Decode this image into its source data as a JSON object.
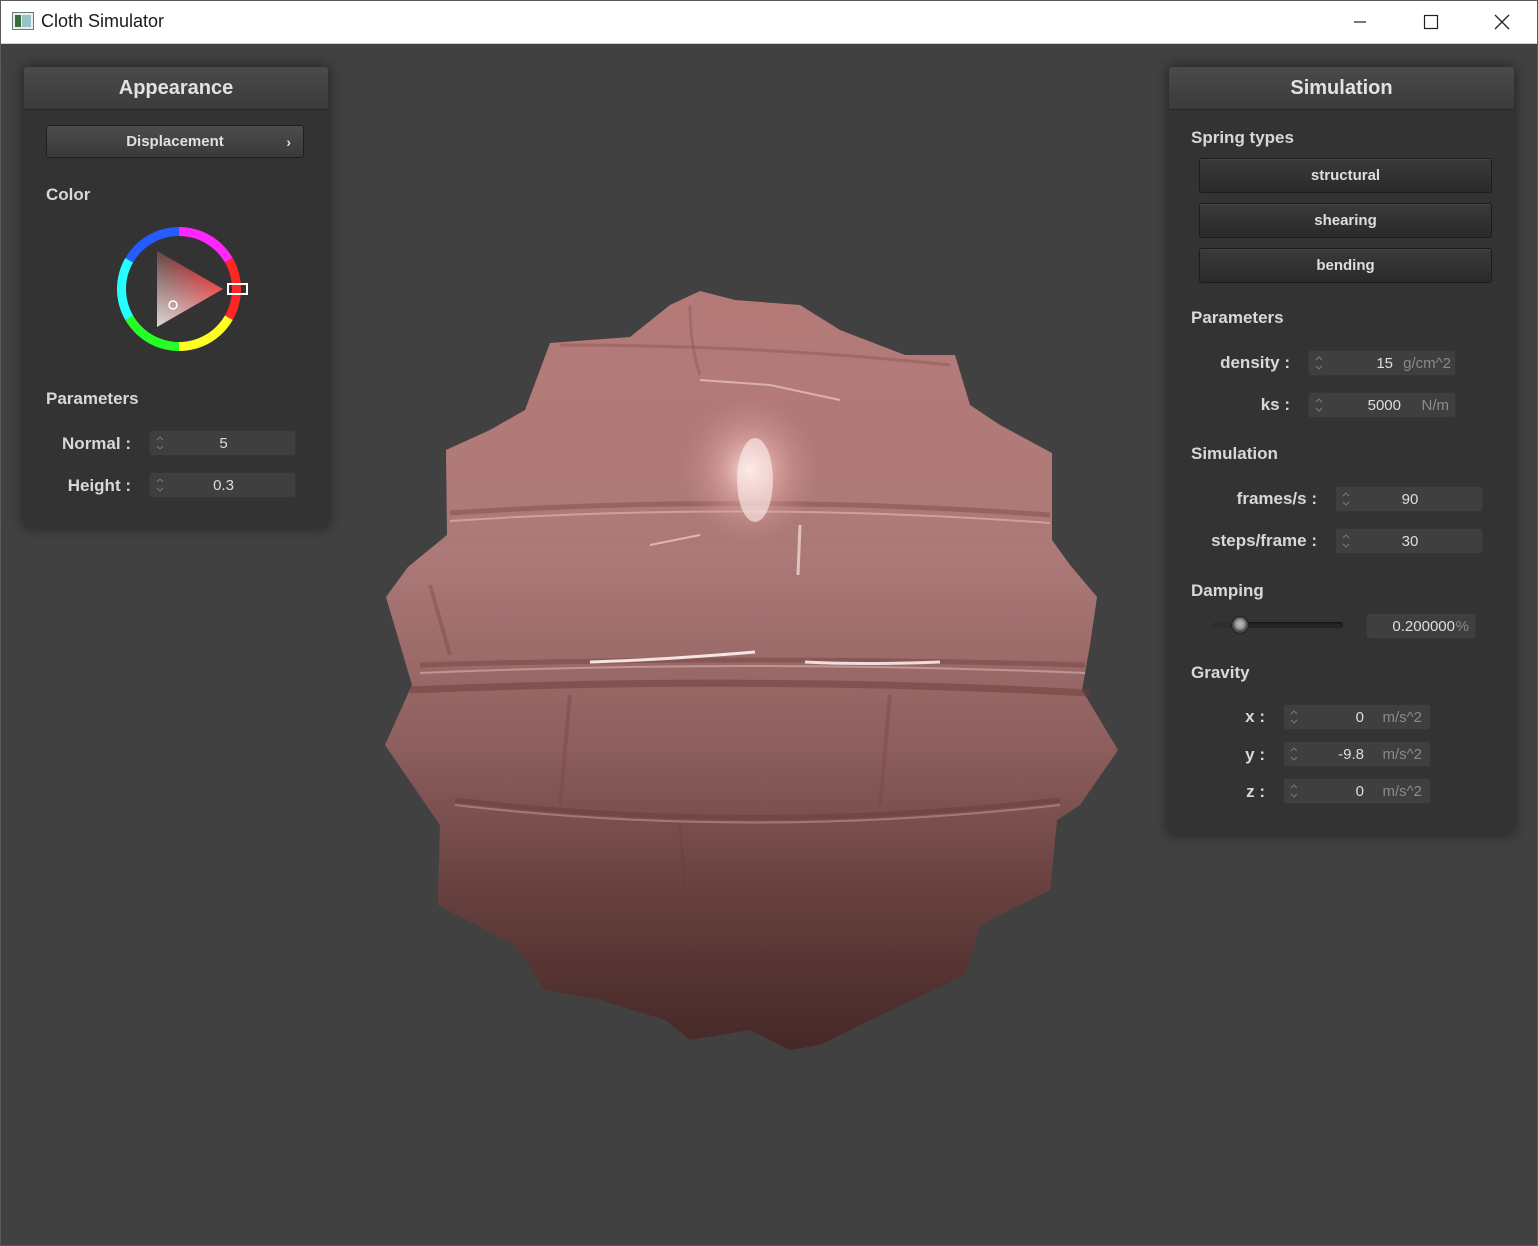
{
  "window": {
    "title": "Cloth Simulator",
    "app_icon": "app-icon"
  },
  "appearance": {
    "title": "Appearance",
    "shader_button": "Displacement",
    "color_label": "Color",
    "color_value": "#e8463c",
    "parameters_label": "Parameters",
    "normal_label": "Normal :",
    "normal_value": "5",
    "height_label": "Height :",
    "height_value": "0.3"
  },
  "simulation": {
    "title": "Simulation",
    "spring_types_label": "Spring types",
    "spring_buttons": [
      "structural",
      "shearing",
      "bending"
    ],
    "parameters_label": "Parameters",
    "density_label": "density :",
    "density_value": "15",
    "density_unit": "g/cm^2",
    "ks_label": "ks :",
    "ks_value": "5000",
    "ks_unit": "N/m",
    "simulation_label": "Simulation",
    "fps_label": "frames/s :",
    "fps_value": "90",
    "steps_label": "steps/frame :",
    "steps_value": "30",
    "damping_label": "Damping",
    "damping_fraction": 0.2,
    "damping_value": "0.200000",
    "damping_unit": "%",
    "gravity_label": "Gravity",
    "gx_label": "x :",
    "gx_value": "0",
    "gy_label": "y :",
    "gy_value": "-9.8",
    "gz_label": "z :",
    "gz_value": "0",
    "gravity_unit": "m/s^2"
  },
  "colors": {
    "background": "#414141",
    "panel": "#333333",
    "cloth": "#c48a88"
  }
}
